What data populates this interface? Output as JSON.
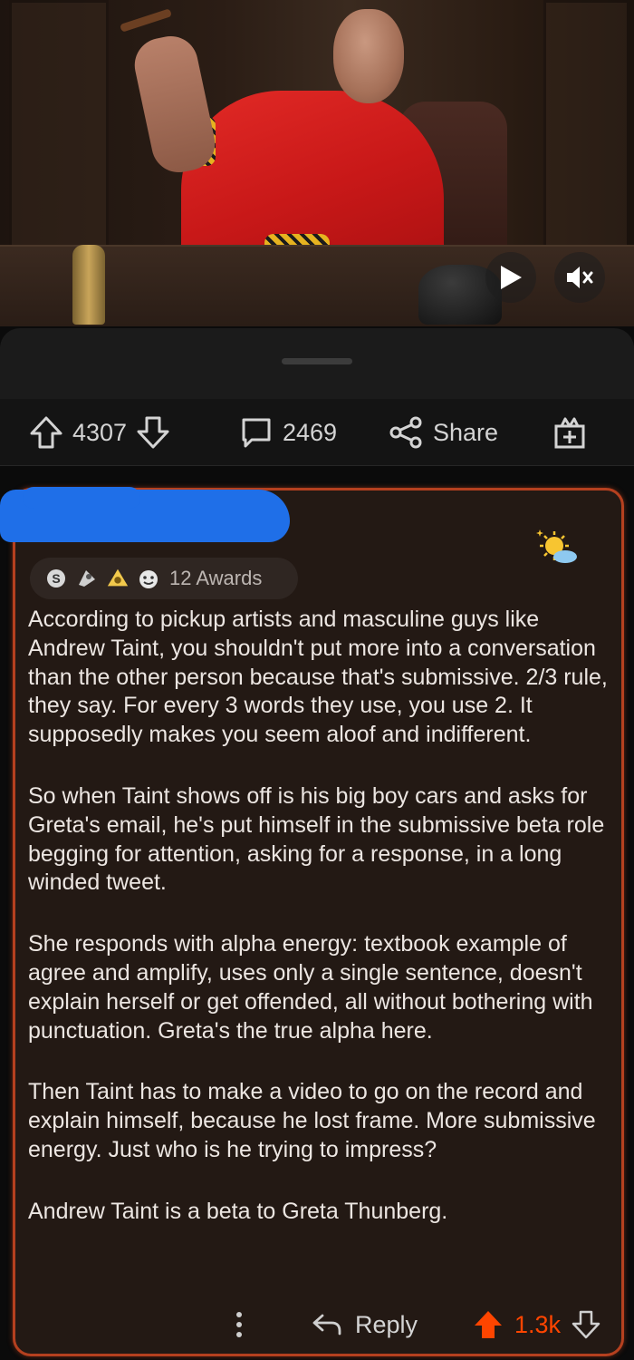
{
  "video": {
    "play_icon": "play-icon",
    "mute_icon": "volume-muted-icon"
  },
  "actions": {
    "upvotes": "4307",
    "comments": "2469",
    "share_label": "Share",
    "icons": [
      "upvote-arrow-icon",
      "downvote-arrow-icon",
      "comment-bubble-icon",
      "share-icon",
      "award-gift-icon"
    ]
  },
  "comment": {
    "awards_label": "12 Awards",
    "award_icons": [
      "silver-award-icon",
      "rocket-like-award-icon",
      "helpful-award-icon",
      "wholesome-award-icon"
    ],
    "paragraphs": [
      "According to pickup artists and masculine guys like Andrew Taint, you shouldn't put more into a conversation than the other person because that's submissive. 2/3 rule, they say. For every 3 words they use, you use 2. It supposedly makes you seem aloof and indifferent.",
      "So when Taint shows off is his big boy cars and asks for Greta's email, he's put himself in the submissive beta role begging for attention, asking for a response, in a long winded tweet.",
      "She responds with alpha energy: textbook example of agree and amplify, uses only a single sentence, doesn't explain herself or get offended, all without bothering with punctuation. Greta's the true alpha here.",
      "Then Taint has to make a video to go on the record and explain himself, because he lost frame. More submissive energy. Just who is he trying to impress?",
      "Andrew Taint is a beta to Greta Thunberg."
    ],
    "reply_label": "Reply",
    "score": "1.3k",
    "accent_color": "#ff4500",
    "border_color": "#b5401f"
  }
}
